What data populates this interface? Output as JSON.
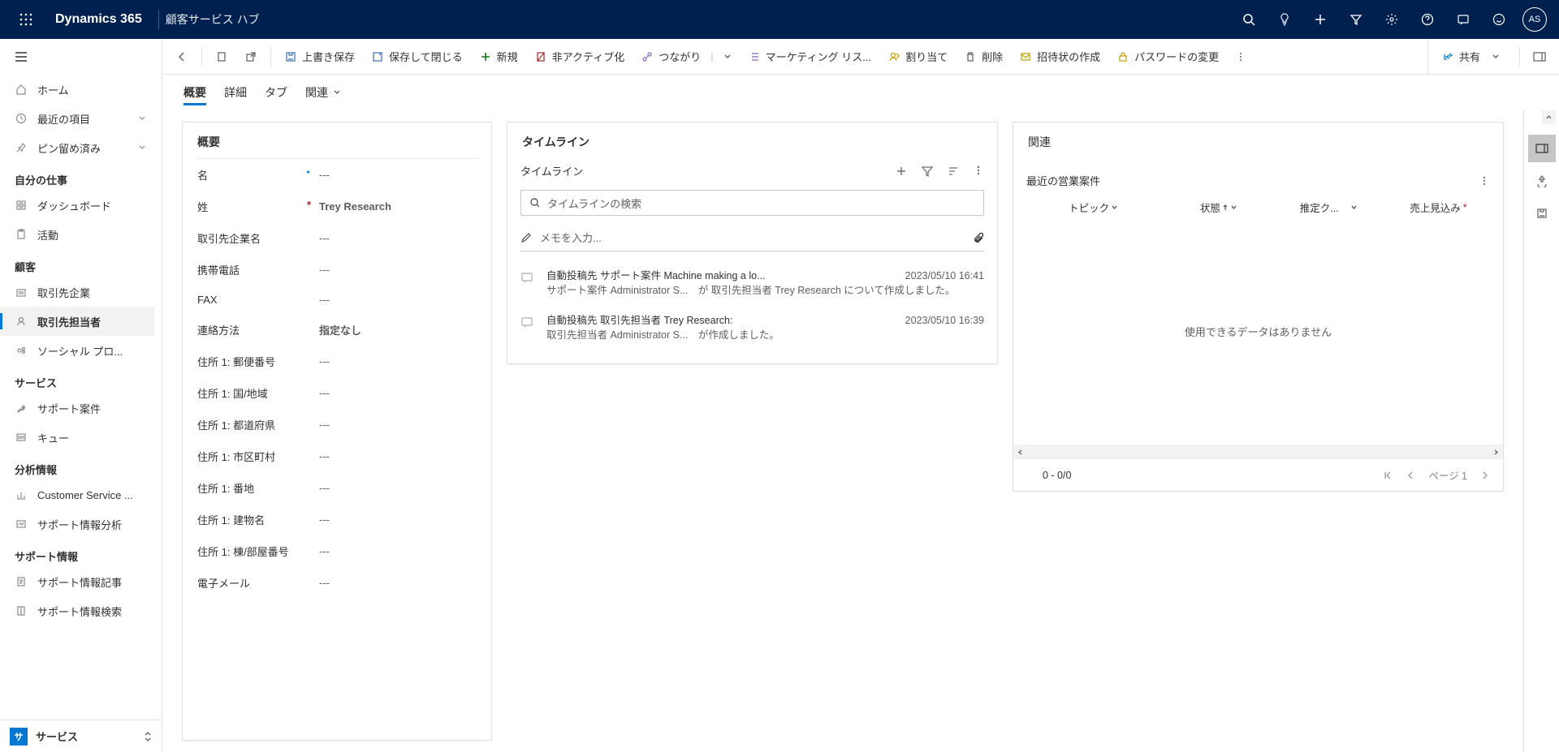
{
  "topnav": {
    "brand": "Dynamics 365",
    "app": "顧客サービス ハブ",
    "avatar": "AS"
  },
  "sidebar": {
    "home": "ホーム",
    "recent": "最近の項目",
    "pinned": "ピン留め済み",
    "groups": [
      {
        "title": "自分の仕事",
        "items": [
          {
            "label": "ダッシュボード",
            "icon": "dashboard"
          },
          {
            "label": "活動",
            "icon": "clipboard"
          }
        ]
      },
      {
        "title": "顧客",
        "items": [
          {
            "label": "取引先企業",
            "icon": "company"
          },
          {
            "label": "取引先担当者",
            "icon": "person",
            "selected": true
          },
          {
            "label": "ソーシャル プロ...",
            "icon": "social"
          }
        ]
      },
      {
        "title": "サービス",
        "items": [
          {
            "label": "サポート案件",
            "icon": "wrench"
          },
          {
            "label": "キュー",
            "icon": "queue"
          }
        ]
      },
      {
        "title": "分析情報",
        "items": [
          {
            "label": "Customer Service ...",
            "icon": "chart"
          },
          {
            "label": "サポート情報分析",
            "icon": "analytics"
          }
        ]
      },
      {
        "title": "サポート情報",
        "items": [
          {
            "label": "サポート情報記事",
            "icon": "article"
          },
          {
            "label": "サポート情報検索",
            "icon": "book"
          }
        ]
      }
    ],
    "bottom": {
      "badge": "サ",
      "label": "サービス"
    }
  },
  "cmdbar": {
    "save": "上書き保存",
    "saveClose": "保存して閉じる",
    "new": "新規",
    "deactivate": "非アクティブ化",
    "connect": "つながり",
    "marketing": "マーケティング リス...",
    "assign": "割り当て",
    "delete": "削除",
    "invite": "招待状の作成",
    "password": "パスワードの変更",
    "share": "共有"
  },
  "tabs": {
    "t1": "概要",
    "t2": "詳細",
    "t3": "タブ",
    "t4": "関連"
  },
  "overview": {
    "title": "概要",
    "fields": [
      {
        "label": "名",
        "req": "rec",
        "value": "---",
        "empty": true
      },
      {
        "label": "姓",
        "req": "star",
        "value": "Trey Research",
        "empty": false
      },
      {
        "label": "取引先企業名",
        "value": "---",
        "empty": true
      },
      {
        "label": "携帯電話",
        "value": "---",
        "empty": true
      },
      {
        "label": "FAX",
        "value": "---",
        "empty": true
      },
      {
        "label": "連絡方法",
        "value": "指定なし",
        "empty": false
      },
      {
        "label": "住所 1: 郵便番号",
        "value": "---",
        "empty": true
      },
      {
        "label": "住所 1: 国/地域",
        "value": "---",
        "empty": true
      },
      {
        "label": "住所 1: 都道府県",
        "value": "---",
        "empty": true
      },
      {
        "label": "住所 1: 市区町村",
        "value": "---",
        "empty": true
      },
      {
        "label": "住所 1: 番地",
        "value": "---",
        "empty": true
      },
      {
        "label": "住所 1: 建物名",
        "value": "---",
        "empty": true
      },
      {
        "label": "住所 1: 棟/部屋番号",
        "value": "---",
        "empty": true
      },
      {
        "label": "電子メール",
        "value": "---",
        "empty": true
      }
    ]
  },
  "timeline": {
    "cardTitle": "タイムライン",
    "headerTitle": "タイムライン",
    "searchPlaceholder": "タイムラインの検索",
    "notePlaceholder": "メモを入力...",
    "entries": [
      {
        "title": "自動投稿先 サポート案件 Machine making a lo...",
        "date": "2023/05/10 16:41",
        "desc": "サポート案件 Administrator S...　が 取引先担当者  Trey Research について作成しました。"
      },
      {
        "title": "自動投稿先 取引先担当者 Trey Research:",
        "date": "2023/05/10 16:39",
        "desc": "取引先担当者 Administrator S...　が作成しました。"
      }
    ]
  },
  "related": {
    "cardTitle": "関連",
    "sectionTitle": "最近の営業案件",
    "columns": [
      "トピック",
      "状態",
      "推定ク...",
      "売上見込み"
    ],
    "empty": "使用できるデータはありません",
    "pager": {
      "range": "0 - 0/0",
      "page": "ページ 1"
    }
  }
}
